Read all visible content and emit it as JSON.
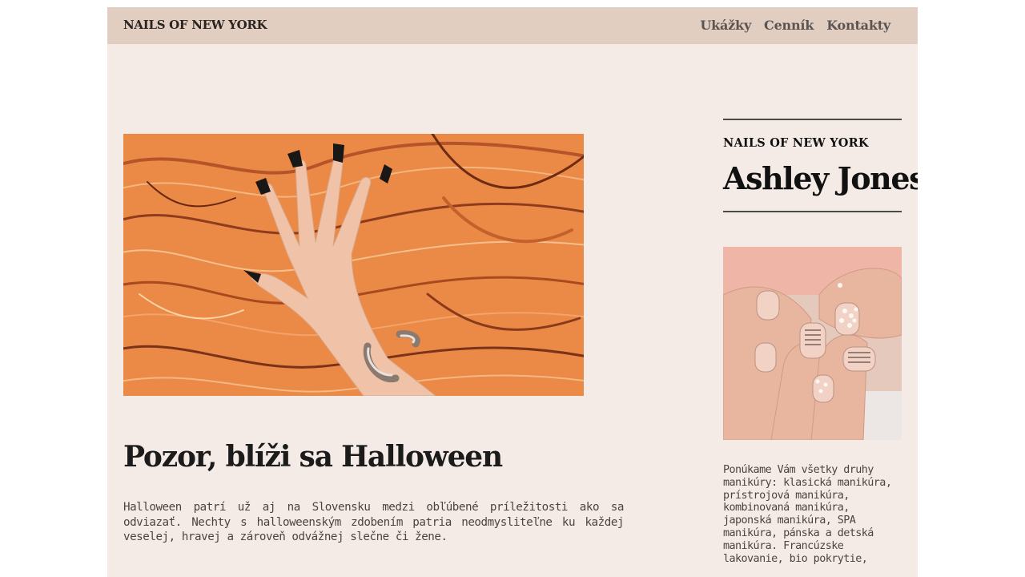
{
  "header": {
    "brand": "NAILS OF NEW YORK",
    "nav": [
      {
        "label": "Ukážky"
      },
      {
        "label": "Cenník"
      },
      {
        "label": "Kontakty"
      }
    ]
  },
  "post": {
    "title": "Pozor, blíži sa Halloween",
    "text": "Halloween patrí už aj na Slovensku medzi obľúbené príležitosti ako sa odviazať. Nechty s halloweenským zdobením patria neodmysliteľne ku každej veselej, hravej a zároveň odvážnej slečne či žene."
  },
  "sidebar": {
    "brand": "NAILS OF NEW YORK",
    "name": "Ashley Jones",
    "text": "Ponúkame Vám všetky druhy manikúry: klasická manikúra, prístrojová manikúra, kombinovaná manikúra, japonská manikúra, SPA manikúra, pánska a detská manikúra. Francúzske lakovanie, bio pokrytie,"
  },
  "colors": {
    "page_bg": "#f5ebe6",
    "header_bg": "#e2cdc1",
    "hero_orange": "#e98a47"
  }
}
